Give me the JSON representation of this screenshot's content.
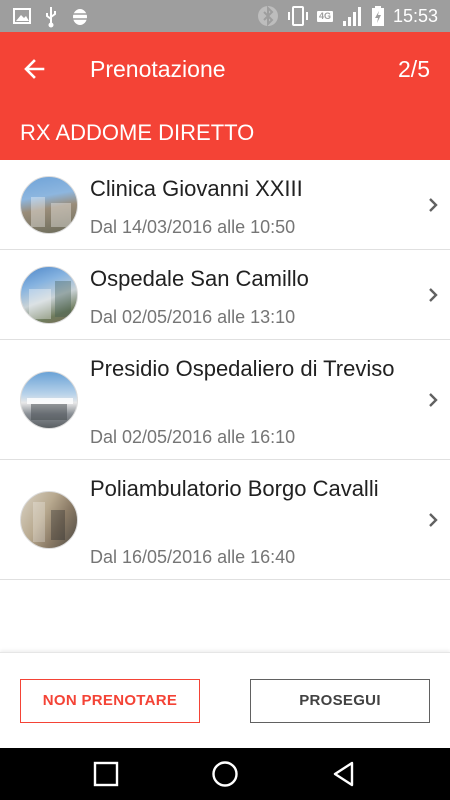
{
  "status_bar": {
    "time": "15:53",
    "network": "4G",
    "left_icons": [
      "image-icon",
      "usb-icon",
      "android-debug-icon"
    ],
    "right_icons": [
      "bluetooth-icon",
      "vibrate-icon",
      "network-4g-icon",
      "signal-icon",
      "battery-charging-icon"
    ]
  },
  "app_bar": {
    "title": "Prenotazione",
    "step": "2/5",
    "exam": "RX ADDOME DIRETTO",
    "color": "#f44336"
  },
  "facilities": [
    {
      "name": "Clinica Giovanni XXIII",
      "date": "Dal 14/03/2016 alle 10:50"
    },
    {
      "name": "Ospedale San Camillo",
      "date": "Dal 02/05/2016 alle 13:10"
    },
    {
      "name": "Presidio Ospedaliero di Treviso",
      "date": "Dal 02/05/2016 alle 16:10"
    },
    {
      "name": "Poliambulatorio Borgo Cavalli",
      "date": "Dal 16/05/2016 alle 16:40"
    }
  ],
  "actions": {
    "skip_label": "NON PRENOTARE",
    "next_label": "PROSEGUI"
  },
  "nav_bar": {
    "buttons": [
      "recents-square-icon",
      "home-circle-icon",
      "back-triangle-icon"
    ]
  }
}
